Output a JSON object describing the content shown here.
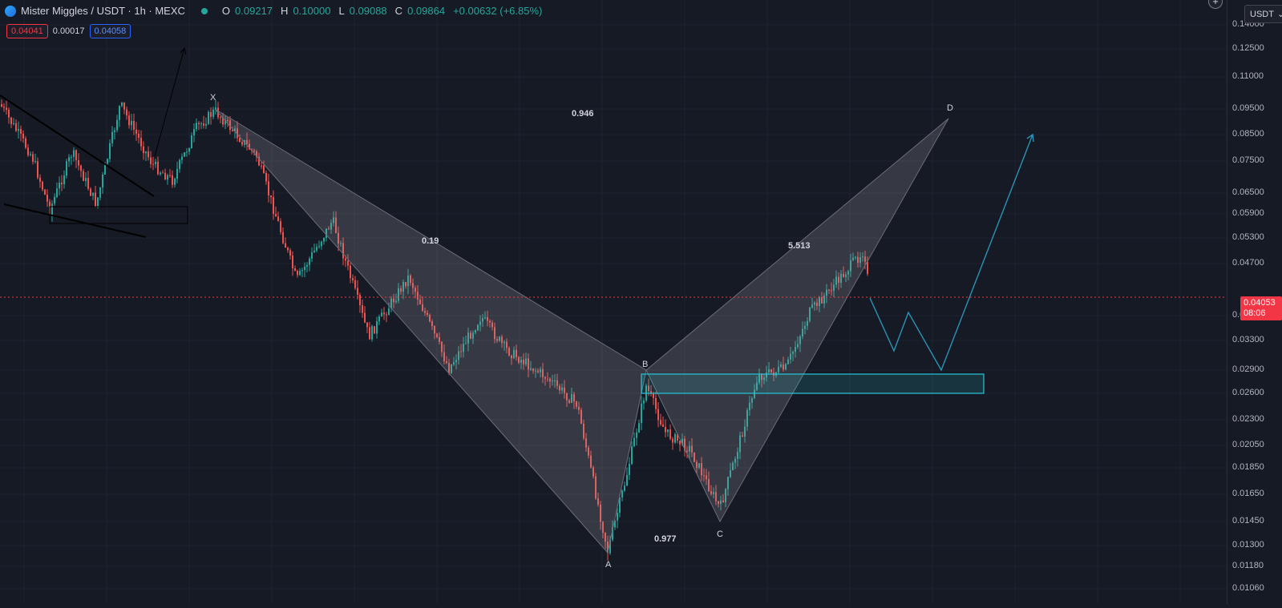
{
  "header": {
    "symbol": "Mister Miggles / USDT · 1h · MEXC",
    "open_key": "O",
    "open": "0.09217",
    "high_key": "H",
    "high": "0.10000",
    "low_key": "L",
    "low": "0.09088",
    "close_key": "C",
    "close": "0.09864",
    "change": "+0.00632 (+6.85%)"
  },
  "quote": {
    "bid": "0.04041",
    "spread": "0.00017",
    "ask": "0.04058"
  },
  "currency": {
    "label": "USDT"
  },
  "price_tag": {
    "price": "0.04053",
    "countdown": "08:06"
  },
  "price_axis": [
    "0.14000",
    "0.12500",
    "0.11000",
    "0.09500",
    "0.08500",
    "0.07500",
    "0.06500",
    "0.05900",
    "0.05300",
    "0.04700",
    "0.03700",
    "0.03300",
    "0.02900",
    "0.02600",
    "0.02300",
    "0.02050",
    "0.01850",
    "0.01650",
    "0.01450",
    "0.01300",
    "0.01180",
    "0.01060"
  ],
  "pattern": {
    "points": {
      "x": "X",
      "a": "A",
      "b": "B",
      "c": "C",
      "d": "D"
    },
    "ratios": {
      "xb": "0.946",
      "ab": "0.19",
      "bc": "0.977",
      "cd": "5.513"
    }
  },
  "colors": {
    "up": "#26a69a",
    "down": "#ef5350",
    "zone": "#26c6da",
    "pattern": "#5d606b"
  }
}
